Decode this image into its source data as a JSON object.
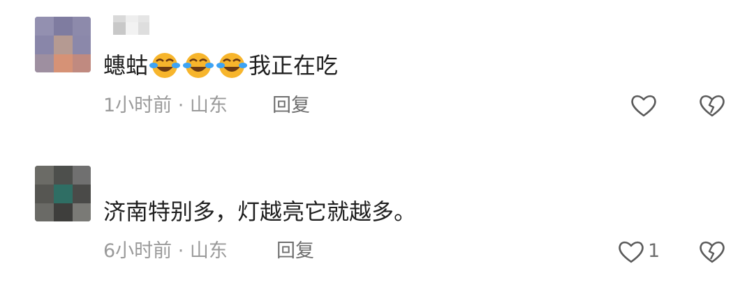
{
  "comments": [
    {
      "text_before": "蟪蛄",
      "emojis": [
        "face-with-tears-of-joy-icon",
        "face-with-tears-of-joy-icon",
        "face-with-tears-of-joy-icon"
      ],
      "text_after": "我正在吃",
      "meta": "1小时前 · 山东",
      "reply_label": "回复",
      "like_count": ""
    },
    {
      "text_before": "济南特别多，灯越亮它就越多。",
      "emojis": [],
      "text_after": "",
      "meta": "6小时前 · 山东",
      "reply_label": "回复",
      "like_count": "1"
    }
  ],
  "colors": {
    "text": "#1f1f1f",
    "meta": "#9a9a9a",
    "action": "#6e6e6e"
  }
}
